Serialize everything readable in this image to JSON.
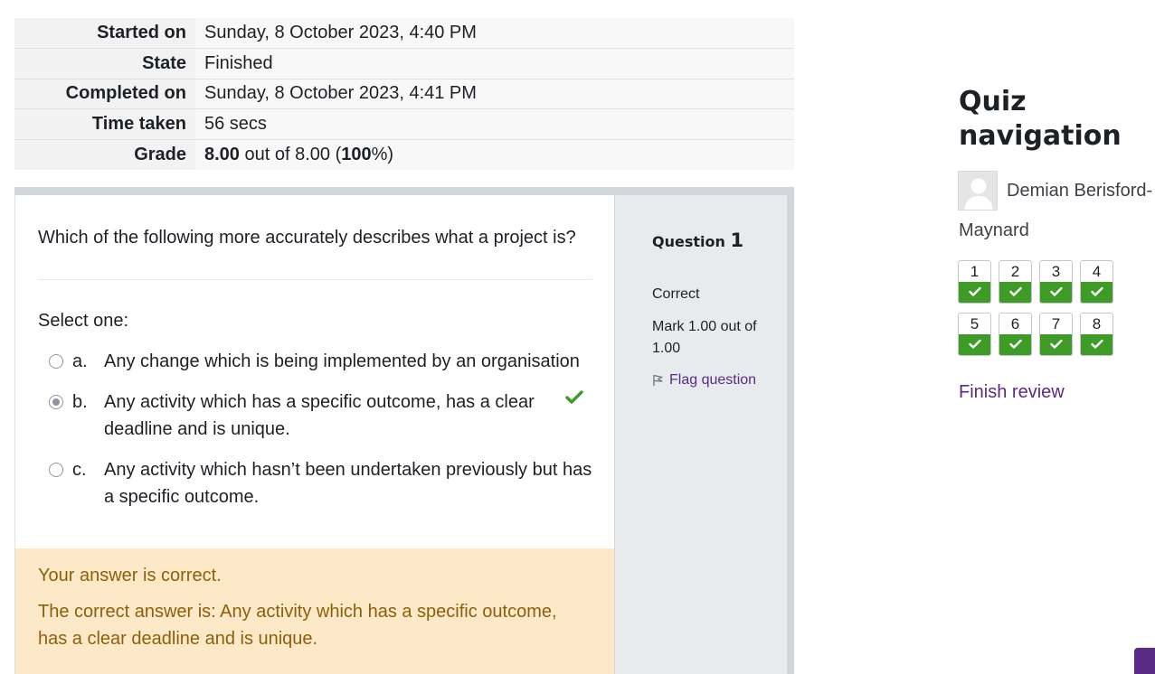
{
  "summary": {
    "rows": [
      {
        "label": "Started on",
        "value": "Sunday, 8 October 2023, 4:40 PM"
      },
      {
        "label": "State",
        "value": "Finished"
      },
      {
        "label": "Completed on",
        "value": "Sunday, 8 October 2023, 4:41 PM"
      },
      {
        "label": "Time taken",
        "value": "56 secs"
      }
    ],
    "grade_label": "Grade",
    "grade_score": "8.00",
    "grade_mid": " out of 8.00 (",
    "grade_percent": "100",
    "grade_end": "%)"
  },
  "question": {
    "label": "Question",
    "number": "1",
    "state": "Correct",
    "mark": "Mark 1.00 out of 1.00",
    "flag_label": "Flag question",
    "text": "Which of the following more accurately describes what a project is?",
    "prompt": "Select one:",
    "answers": [
      {
        "letter": "a.",
        "text": "Any change which is being implemented by an organisation",
        "selected": false
      },
      {
        "letter": "b.",
        "text": "Any activity which has a specific outcome, has a clear deadline and is unique.",
        "selected": true
      },
      {
        "letter": "c.",
        "text": "Any activity which hasn’t been undertaken previously but has a specific outcome.",
        "selected": false
      }
    ],
    "feedback_result": "Your answer is correct.",
    "feedback_correct": "The correct answer is: Any activity which has a specific outcome, has a clear deadline and is unique."
  },
  "navigation": {
    "title": "Quiz navigation",
    "user_first": "Demian Berisford-",
    "user_second": "Maynard",
    "questions": [
      "1",
      "2",
      "3",
      "4",
      "5",
      "6",
      "7",
      "8"
    ],
    "finish_label": "Finish review"
  },
  "colors": {
    "correct_green": "#3e9b26",
    "link_purple": "#5b2a86",
    "feedback_bg": "#fde8c8",
    "feedback_text": "#8e5f0a"
  }
}
